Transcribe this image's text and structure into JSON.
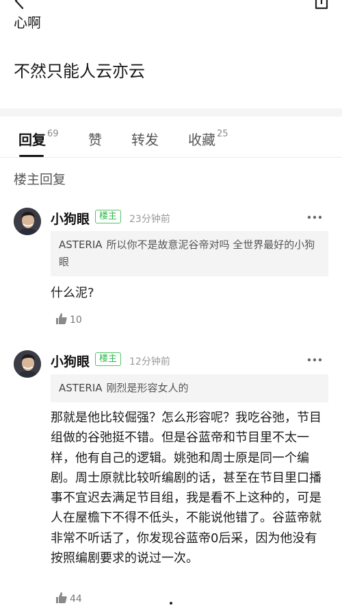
{
  "post": {
    "cut_line": "心啊",
    "text": "不然只能人云亦云"
  },
  "tabs": [
    {
      "label": "回复",
      "count": "69"
    },
    {
      "label": "赞",
      "count": ""
    },
    {
      "label": "转发",
      "count": ""
    },
    {
      "label": "收藏",
      "count": "25"
    }
  ],
  "section_title": "楼主回复",
  "replies": [
    {
      "user": "小狗眼",
      "badge": "楼主",
      "time": "23分钟前",
      "quote_user": "ASTERIA",
      "quote_text": "所以你不是故意泥谷帝对吗 全世界最好的小狗眼",
      "text": "什么泥?",
      "likes": "10"
    },
    {
      "user": "小狗眼",
      "badge": "楼主",
      "time": "12分钟前",
      "quote_user": "ASTERIA",
      "quote_text": "刚烈是形容女人的",
      "text": "那就是他比较倔强？怎么形容呢？我吃谷弛，节目组做的谷弛挺不错。但是谷蓝帝和节目里不太一样，他有自己的逻辑。姚弛和周士原是同一个编剧。周士原就比较听编剧的话，甚至在节目里口播事不宜迟去满足节目组，我是看不上这种的，可是人在屋檐下不得不低头，不能说他错了。谷蓝帝就非常不听话了，你发现谷蓝帝0后采，因为他没有按照编剧要求的说过一次。",
      "likes": "44"
    }
  ],
  "icons": {
    "back": "back-arrow-icon",
    "share": "share-icon",
    "more": "more-dots-icon",
    "like": "thumb-up-icon"
  },
  "colors": {
    "badge_green": "#2db84a",
    "quote_bg": "#f4f4f4"
  }
}
